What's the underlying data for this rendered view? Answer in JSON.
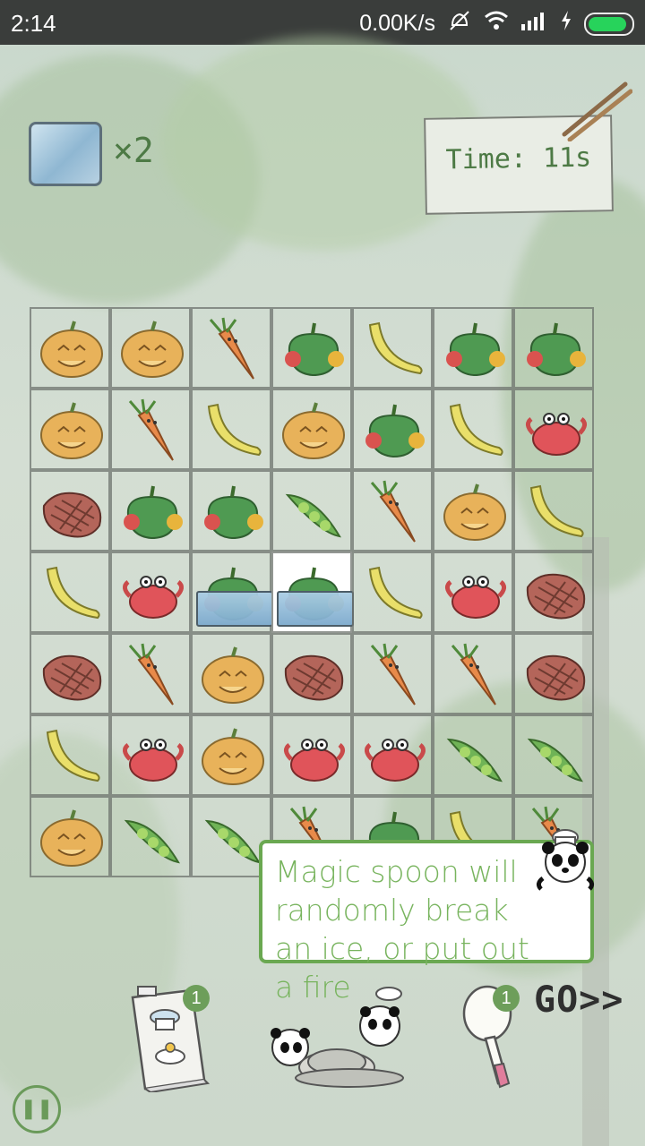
{
  "status_bar": {
    "time": "2:14",
    "network_speed": "0.00K/s"
  },
  "hud": {
    "ice_count": "×2",
    "timer": "Time: 11s"
  },
  "grid": {
    "rows": [
      [
        "pumpkin",
        "pumpkin",
        "carrot",
        "pepper",
        "banana",
        "pepper",
        "pepper"
      ],
      [
        "pumpkin",
        "carrot",
        "banana",
        "pumpkin",
        "pepper",
        "banana",
        "crab"
      ],
      [
        "steak",
        "pepper",
        "pepper",
        "peas",
        "carrot",
        "pumpkin",
        "banana"
      ],
      [
        "banana",
        "crab",
        "pepper-ice",
        "pepper-ice-selected",
        "banana",
        "crab",
        "steak"
      ],
      [
        "steak",
        "carrot",
        "pumpkin",
        "steak",
        "carrot",
        "carrot",
        "steak"
      ],
      [
        "banana",
        "crab",
        "pumpkin",
        "crab",
        "crab",
        "peas",
        "peas"
      ],
      [
        "pumpkin",
        "peas",
        "peas",
        "carrot",
        "pepper",
        "banana",
        "carrot"
      ]
    ]
  },
  "tooltip": {
    "text": "Magic spoon will randomly break an ice, or put out a fire"
  },
  "tools": {
    "recipe_badge": "1",
    "spoon_badge": "1",
    "go_label": "GO>>"
  },
  "colors": {
    "accent_green": "#6aa851",
    "text_green": "#4d7a45"
  }
}
